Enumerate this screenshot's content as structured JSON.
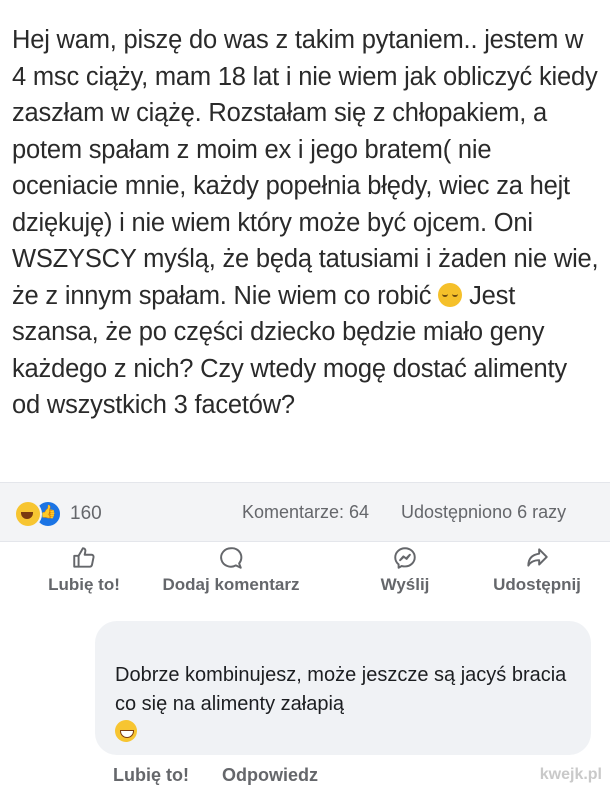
{
  "post": {
    "text_before_emoji": "Hej wam, piszę do was z takim pytaniem.. jestem w 4 msc ciąży, mam 18 lat i nie wiem jak obliczyć kiedy zaszłam w ciążę. Rozstałam się z chłopakiem, a potem spałam z moim ex i jego bratem( nie oceniacie mnie, każdy popełnia błędy, wiec za hejt dziękuję)  i nie wiem który może być ojcem. Oni WSZYSCY myślą, że będą tatusiami i żaden nie wie, że  z innym spałam. Nie wiem co robić",
    "emoji": "sleepy-face-emoji",
    "text_after_emoji": " Jest szansa, że po części dziecko będzie miało geny każdego z nich? Czy wtedy mogę dostać alimenty od wszystkich 3 facetów?"
  },
  "stats": {
    "reaction_icons": [
      "haha-reaction-icon",
      "like-reaction-icon"
    ],
    "reaction_count": "160",
    "comments": "Komentarze: 64",
    "shares": "Udostępniono 6 razy"
  },
  "actions": {
    "like": "Lubię to!",
    "comment": "Dodaj komentarz",
    "send": "Wyślij",
    "share": "Udostępnij"
  },
  "comment": {
    "text": "Dobrze kombinujesz,  może jeszcze są jacyś bracia co się na alimenty załapią",
    "emoji": "grinning-sweat-emoji",
    "like": "Lubię to!",
    "reply": "Odpowiedz"
  },
  "watermark": "kwejk.pl",
  "colors": {
    "background": "#ffffff",
    "stats_bar": "#f3f4f6",
    "muted_text": "#65676b",
    "comment_bubble": "#f0f2f5",
    "like_blue": "#1b74e4"
  }
}
